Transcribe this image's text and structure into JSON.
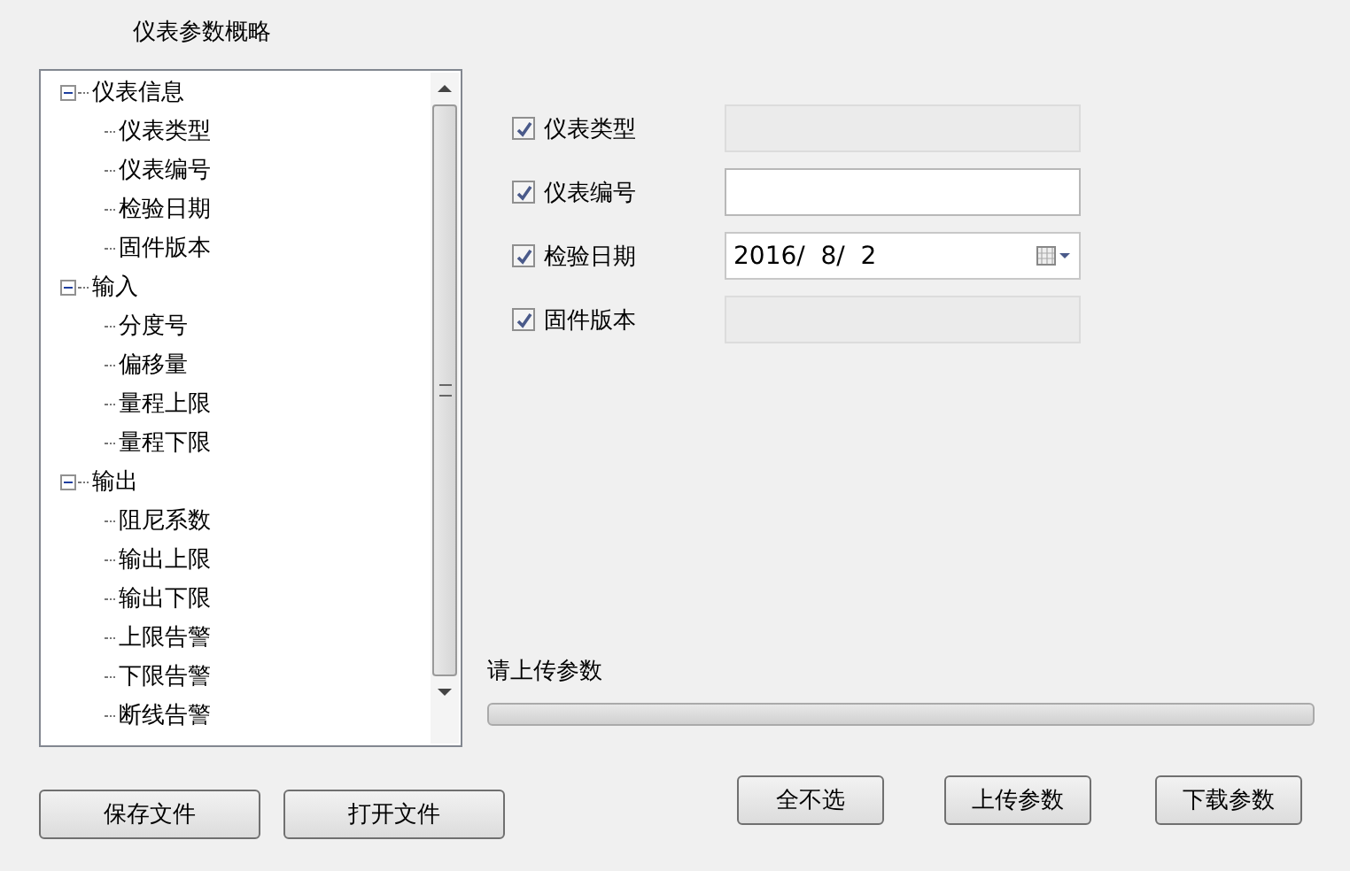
{
  "group_title": "仪表参数概略",
  "tree": [
    {
      "label": "仪表信息",
      "expanded": true,
      "children": [
        {
          "label": "仪表类型"
        },
        {
          "label": "仪表编号"
        },
        {
          "label": "检验日期"
        },
        {
          "label": "固件版本"
        }
      ]
    },
    {
      "label": "输入",
      "expanded": true,
      "children": [
        {
          "label": "分度号"
        },
        {
          "label": "偏移量"
        },
        {
          "label": "量程上限"
        },
        {
          "label": "量程下限"
        }
      ]
    },
    {
      "label": "输出",
      "expanded": true,
      "children": [
        {
          "label": "阻尼系数"
        },
        {
          "label": "输出上限"
        },
        {
          "label": "输出下限"
        },
        {
          "label": "上限告警"
        },
        {
          "label": "下限告警"
        },
        {
          "label": "断线告警"
        }
      ]
    }
  ],
  "fields": [
    {
      "label": "仪表类型",
      "checked": true,
      "kind": "text",
      "disabled": true
    },
    {
      "label": "仪表编号",
      "checked": true,
      "kind": "text",
      "disabled": false
    },
    {
      "label": "检验日期",
      "checked": true,
      "kind": "date",
      "value": "2016/  8/  2"
    },
    {
      "label": "固件版本",
      "checked": true,
      "kind": "text",
      "disabled": true
    }
  ],
  "progress": {
    "label": "请上传参数",
    "level": 0
  },
  "left_buttons": [
    "保存文件",
    "打开文件"
  ],
  "right_buttons": [
    "全不选",
    "上传参数",
    "下载参数"
  ]
}
